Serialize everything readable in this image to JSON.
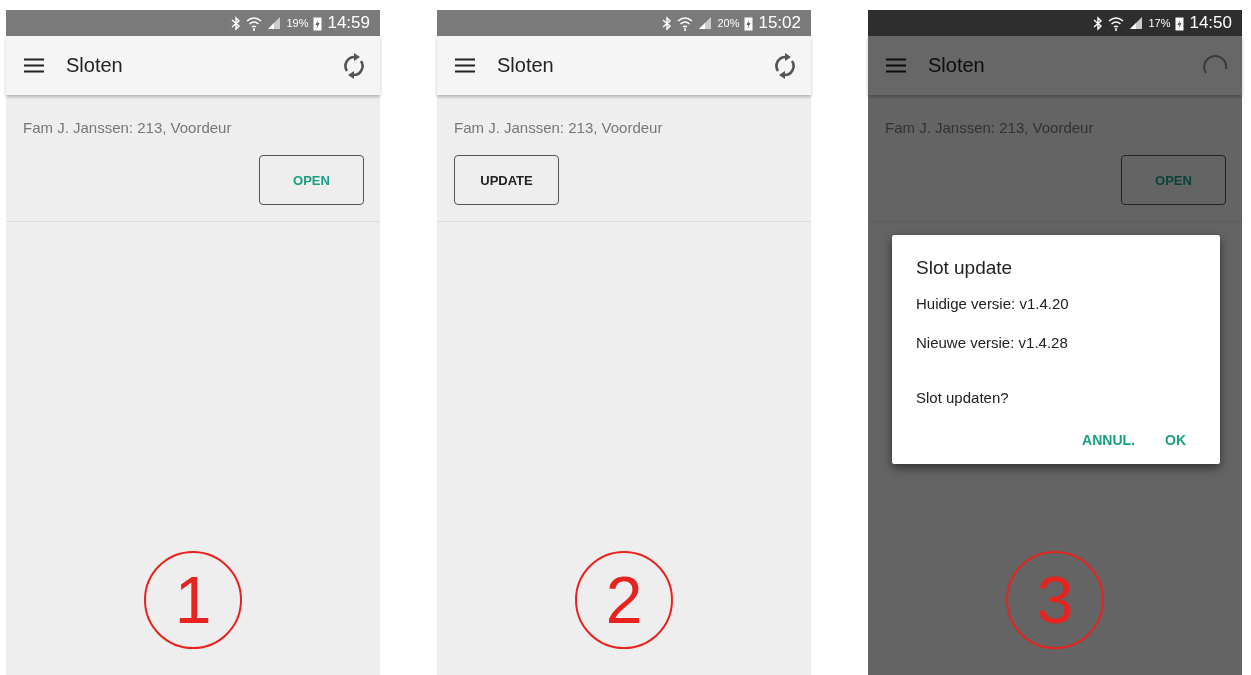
{
  "screens": [
    {
      "step": "1",
      "status_bar": {
        "battery": "19%",
        "time": "14:59"
      },
      "app_bar": {
        "title": "Sloten",
        "syncing": false
      },
      "item": {
        "text": "Fam J. Janssen: 213, Voordeur",
        "button": {
          "kind": "open",
          "label": "OPEN"
        }
      }
    },
    {
      "step": "2",
      "status_bar": {
        "battery": "20%",
        "time": "15:02"
      },
      "app_bar": {
        "title": "Sloten",
        "syncing": false
      },
      "item": {
        "text": "Fam J. Janssen: 213, Voordeur",
        "button": {
          "kind": "update",
          "label": "UPDATE"
        }
      }
    },
    {
      "step": "3",
      "status_bar": {
        "battery": "17%",
        "time": "14:50"
      },
      "app_bar": {
        "title": "Sloten",
        "syncing": true
      },
      "item": {
        "text": "Fam J. Janssen: 213, Voordeur",
        "button": {
          "kind": "open",
          "label": "OPEN"
        }
      },
      "dialog": {
        "title": "Slot update",
        "lines": [
          "Huidige versie: v1.4.20",
          "Nieuwe versie: v1.4.28"
        ],
        "question": "Slot updaten?",
        "buttons": [
          "ANNUL.",
          "OK"
        ]
      }
    }
  ]
}
